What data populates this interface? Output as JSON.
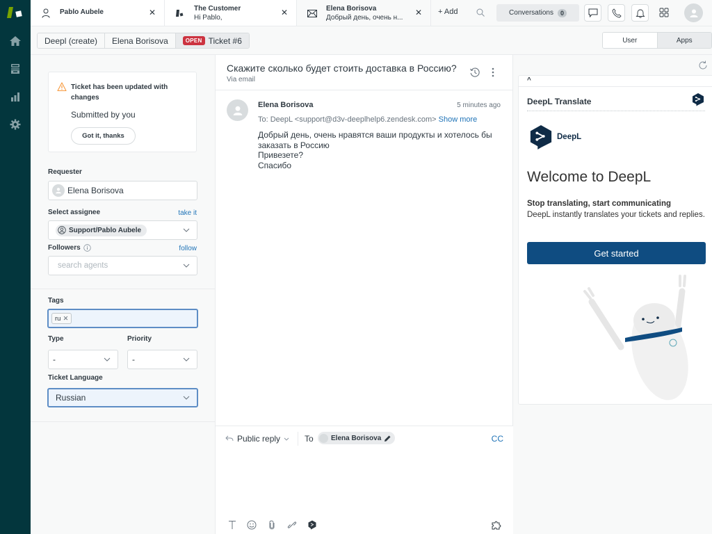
{
  "nav": {
    "items": [
      {
        "name": "home",
        "icon": "home-icon"
      },
      {
        "name": "views",
        "icon": "views-icon"
      },
      {
        "name": "reporting",
        "icon": "bar-chart-icon"
      },
      {
        "name": "admin",
        "icon": "gear-icon"
      }
    ]
  },
  "tabs": [
    {
      "title": "Pablo Aubele",
      "subtitle": "",
      "icon": "user-icon"
    },
    {
      "title": "The Customer",
      "subtitle": "Hi Pablo,",
      "icon": "organization-icon"
    },
    {
      "title": "Elena Borisova",
      "subtitle": "Добрый день, очень н...",
      "icon": "envelope-icon"
    }
  ],
  "topbar": {
    "add_label": "+ Add",
    "conversations_label": "Conversations",
    "conversations_count": "0"
  },
  "breadcrumb": {
    "items": [
      "Deepl (create)",
      "Elena Borisova",
      "Ticket #6"
    ],
    "status_badge": "OPEN"
  },
  "context_toggle": {
    "options": [
      "User",
      "Apps"
    ],
    "selected": "Apps"
  },
  "notice": {
    "title": "Ticket has been updated with changes",
    "subtitle": "Submitted by you",
    "button": "Got it, thanks"
  },
  "fields": {
    "requester_label": "Requester",
    "requester_value": "Elena Borisova",
    "assignee_label": "Select assignee",
    "assignee_link": "take it",
    "assignee_value": "Support/Pablo Aubele",
    "followers_label": "Followers",
    "followers_link": "follow",
    "followers_placeholder": "search agents",
    "tags_label": "Tags",
    "tags": [
      "ru"
    ],
    "type_label": "Type",
    "type_value": "-",
    "priority_label": "Priority",
    "priority_value": "-",
    "language_label": "Ticket Language",
    "language_value": "Russian"
  },
  "ticket": {
    "subject": "Скажите сколько будет стоить доставка в Россию?",
    "channel": "Via email",
    "message": {
      "author": "Elena Borisova",
      "time": "5 minutes ago",
      "to": "To: DeepL <support@d3v-deeplhelp6.zendesk.com>",
      "show_more": "Show more",
      "body_lines": [
        "Добрый день, очень нравятся ваши продукты и хотелось бы заказать в Россию",
        "Привезете?",
        "Спасибо"
      ]
    }
  },
  "reply": {
    "type_label": "Public reply",
    "to_label": "To",
    "recipient": "Elena Borisova",
    "cc_label": "CC",
    "body": ""
  },
  "app": {
    "name": "DeepL Translate",
    "brand": "DeepL",
    "welcome": "Welcome to DeepL",
    "tagline_bold": "Stop translating, start communicating",
    "tagline": "DeepL instantly translates your tickets and replies.",
    "cta": "Get started",
    "colors": {
      "brand_navy": "#0f2b46",
      "cta_blue": "#0f4c81"
    }
  }
}
